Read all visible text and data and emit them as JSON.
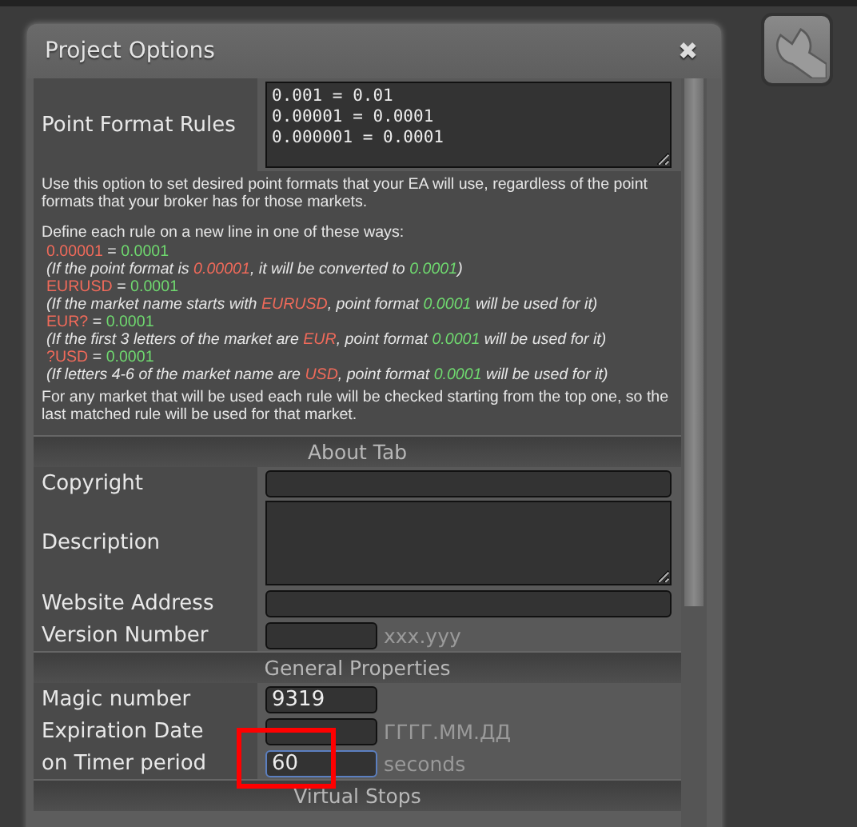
{
  "dialog": {
    "title": "Project Options",
    "close": "✖"
  },
  "point_format": {
    "label": "Point Format Rules",
    "value": "0.001 = 0.01\n0.00001 = 0.0001\n0.000001 = 0.0001"
  },
  "help": {
    "intro": "Use this option to set desired point formats that your EA will use, regardless of the point formats that your broker has for those markets.",
    "define": "Define each rule on a new line in one of these ways:",
    "rules": [
      {
        "kind": "rule",
        "segments": [
          {
            "text": "0.00001",
            "color": "#f06a5a"
          },
          {
            "text": " = "
          },
          {
            "text": "0.0001",
            "color": "#6fd96f"
          }
        ]
      },
      {
        "kind": "note",
        "segments": [
          {
            "text": "(If the point format is "
          },
          {
            "text": "0.00001",
            "color": "#f06a5a"
          },
          {
            "text": ", it will be converted to "
          },
          {
            "text": "0.0001",
            "color": "#6fd96f"
          },
          {
            "text": ")"
          }
        ]
      },
      {
        "kind": "rule",
        "segments": [
          {
            "text": "EURUSD",
            "color": "#f06a5a"
          },
          {
            "text": " = "
          },
          {
            "text": "0.0001",
            "color": "#6fd96f"
          }
        ]
      },
      {
        "kind": "note",
        "segments": [
          {
            "text": "(If the market name starts with "
          },
          {
            "text": "EURUSD",
            "color": "#f06a5a"
          },
          {
            "text": ", point format "
          },
          {
            "text": "0.0001",
            "color": "#6fd96f"
          },
          {
            "text": " will be used for it)"
          }
        ]
      },
      {
        "kind": "rule",
        "segments": [
          {
            "text": "EUR?",
            "color": "#f06a5a"
          },
          {
            "text": " = "
          },
          {
            "text": "0.0001",
            "color": "#6fd96f"
          }
        ]
      },
      {
        "kind": "note",
        "segments": [
          {
            "text": "(If the first 3 letters of the market are "
          },
          {
            "text": "EUR",
            "color": "#f06a5a"
          },
          {
            "text": ", point format "
          },
          {
            "text": "0.0001",
            "color": "#6fd96f"
          },
          {
            "text": " will be used for it)"
          }
        ]
      },
      {
        "kind": "rule",
        "segments": [
          {
            "text": "?USD",
            "color": "#f06a5a"
          },
          {
            "text": " = "
          },
          {
            "text": "0.0001",
            "color": "#6fd96f"
          }
        ]
      },
      {
        "kind": "note",
        "segments": [
          {
            "text": "(If letters 4-6 of the market name are "
          },
          {
            "text": "USD",
            "color": "#f06a5a"
          },
          {
            "text": ", point format "
          },
          {
            "text": "0.0001",
            "color": "#6fd96f"
          },
          {
            "text": " will be used for it)"
          }
        ]
      }
    ],
    "outro": "For any market that will be used each rule will be checked starting from the top one, so the last matched rule will be used for that market."
  },
  "sections": [
    {
      "title": "About Tab",
      "rows": [
        {
          "kind": "text",
          "label": "Copyright"
        },
        {
          "kind": "textarea",
          "label": "Description"
        },
        {
          "kind": "text",
          "label": "Website Address"
        },
        {
          "kind": "short",
          "label": "Version Number",
          "hint": "xxx.yyy",
          "focused": false,
          "highlighted": false
        }
      ]
    },
    {
      "title": "General Properties",
      "rows": [
        {
          "kind": "short",
          "label": "Magic number",
          "value": "9319",
          "focused": false,
          "highlighted": false
        },
        {
          "kind": "short",
          "label": "Expiration Date",
          "hint": "ГГГГ.ММ.ДД",
          "focused": false,
          "highlighted": false
        },
        {
          "kind": "short",
          "label": "on Timer period",
          "value": "60",
          "hint": "seconds",
          "focused": true,
          "highlighted": true
        }
      ]
    },
    {
      "title": "Virtual Stops"
    }
  ]
}
